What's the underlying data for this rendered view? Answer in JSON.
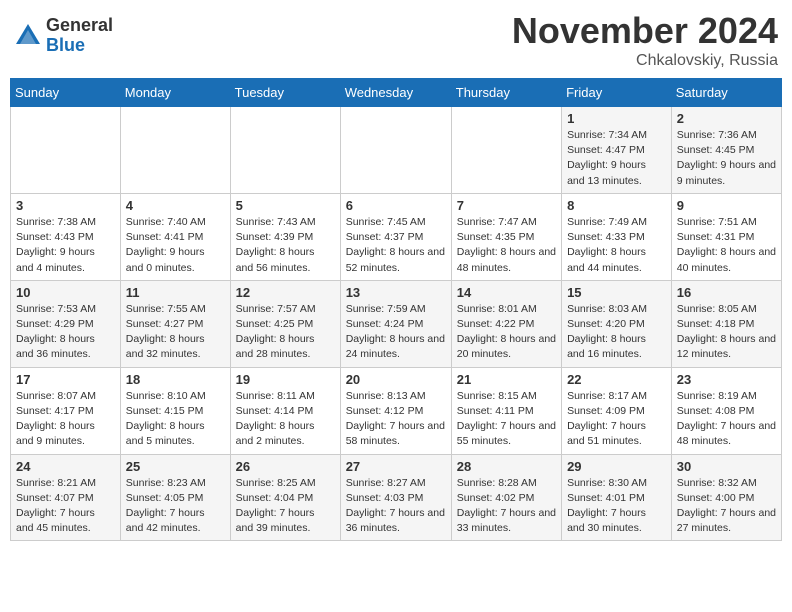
{
  "header": {
    "logo_general": "General",
    "logo_blue": "Blue",
    "month_title": "November 2024",
    "location": "Chkalovskiy, Russia"
  },
  "calendar": {
    "days_of_week": [
      "Sunday",
      "Monday",
      "Tuesday",
      "Wednesday",
      "Thursday",
      "Friday",
      "Saturday"
    ],
    "weeks": [
      [
        {
          "day": "",
          "info": ""
        },
        {
          "day": "",
          "info": ""
        },
        {
          "day": "",
          "info": ""
        },
        {
          "day": "",
          "info": ""
        },
        {
          "day": "",
          "info": ""
        },
        {
          "day": "1",
          "info": "Sunrise: 7:34 AM\nSunset: 4:47 PM\nDaylight: 9 hours and 13 minutes."
        },
        {
          "day": "2",
          "info": "Sunrise: 7:36 AM\nSunset: 4:45 PM\nDaylight: 9 hours and 9 minutes."
        }
      ],
      [
        {
          "day": "3",
          "info": "Sunrise: 7:38 AM\nSunset: 4:43 PM\nDaylight: 9 hours and 4 minutes."
        },
        {
          "day": "4",
          "info": "Sunrise: 7:40 AM\nSunset: 4:41 PM\nDaylight: 9 hours and 0 minutes."
        },
        {
          "day": "5",
          "info": "Sunrise: 7:43 AM\nSunset: 4:39 PM\nDaylight: 8 hours and 56 minutes."
        },
        {
          "day": "6",
          "info": "Sunrise: 7:45 AM\nSunset: 4:37 PM\nDaylight: 8 hours and 52 minutes."
        },
        {
          "day": "7",
          "info": "Sunrise: 7:47 AM\nSunset: 4:35 PM\nDaylight: 8 hours and 48 minutes."
        },
        {
          "day": "8",
          "info": "Sunrise: 7:49 AM\nSunset: 4:33 PM\nDaylight: 8 hours and 44 minutes."
        },
        {
          "day": "9",
          "info": "Sunrise: 7:51 AM\nSunset: 4:31 PM\nDaylight: 8 hours and 40 minutes."
        }
      ],
      [
        {
          "day": "10",
          "info": "Sunrise: 7:53 AM\nSunset: 4:29 PM\nDaylight: 8 hours and 36 minutes."
        },
        {
          "day": "11",
          "info": "Sunrise: 7:55 AM\nSunset: 4:27 PM\nDaylight: 8 hours and 32 minutes."
        },
        {
          "day": "12",
          "info": "Sunrise: 7:57 AM\nSunset: 4:25 PM\nDaylight: 8 hours and 28 minutes."
        },
        {
          "day": "13",
          "info": "Sunrise: 7:59 AM\nSunset: 4:24 PM\nDaylight: 8 hours and 24 minutes."
        },
        {
          "day": "14",
          "info": "Sunrise: 8:01 AM\nSunset: 4:22 PM\nDaylight: 8 hours and 20 minutes."
        },
        {
          "day": "15",
          "info": "Sunrise: 8:03 AM\nSunset: 4:20 PM\nDaylight: 8 hours and 16 minutes."
        },
        {
          "day": "16",
          "info": "Sunrise: 8:05 AM\nSunset: 4:18 PM\nDaylight: 8 hours and 12 minutes."
        }
      ],
      [
        {
          "day": "17",
          "info": "Sunrise: 8:07 AM\nSunset: 4:17 PM\nDaylight: 8 hours and 9 minutes."
        },
        {
          "day": "18",
          "info": "Sunrise: 8:10 AM\nSunset: 4:15 PM\nDaylight: 8 hours and 5 minutes."
        },
        {
          "day": "19",
          "info": "Sunrise: 8:11 AM\nSunset: 4:14 PM\nDaylight: 8 hours and 2 minutes."
        },
        {
          "day": "20",
          "info": "Sunrise: 8:13 AM\nSunset: 4:12 PM\nDaylight: 7 hours and 58 minutes."
        },
        {
          "day": "21",
          "info": "Sunrise: 8:15 AM\nSunset: 4:11 PM\nDaylight: 7 hours and 55 minutes."
        },
        {
          "day": "22",
          "info": "Sunrise: 8:17 AM\nSunset: 4:09 PM\nDaylight: 7 hours and 51 minutes."
        },
        {
          "day": "23",
          "info": "Sunrise: 8:19 AM\nSunset: 4:08 PM\nDaylight: 7 hours and 48 minutes."
        }
      ],
      [
        {
          "day": "24",
          "info": "Sunrise: 8:21 AM\nSunset: 4:07 PM\nDaylight: 7 hours and 45 minutes."
        },
        {
          "day": "25",
          "info": "Sunrise: 8:23 AM\nSunset: 4:05 PM\nDaylight: 7 hours and 42 minutes."
        },
        {
          "day": "26",
          "info": "Sunrise: 8:25 AM\nSunset: 4:04 PM\nDaylight: 7 hours and 39 minutes."
        },
        {
          "day": "27",
          "info": "Sunrise: 8:27 AM\nSunset: 4:03 PM\nDaylight: 7 hours and 36 minutes."
        },
        {
          "day": "28",
          "info": "Sunrise: 8:28 AM\nSunset: 4:02 PM\nDaylight: 7 hours and 33 minutes."
        },
        {
          "day": "29",
          "info": "Sunrise: 8:30 AM\nSunset: 4:01 PM\nDaylight: 7 hours and 30 minutes."
        },
        {
          "day": "30",
          "info": "Sunrise: 8:32 AM\nSunset: 4:00 PM\nDaylight: 7 hours and 27 minutes."
        }
      ]
    ]
  }
}
